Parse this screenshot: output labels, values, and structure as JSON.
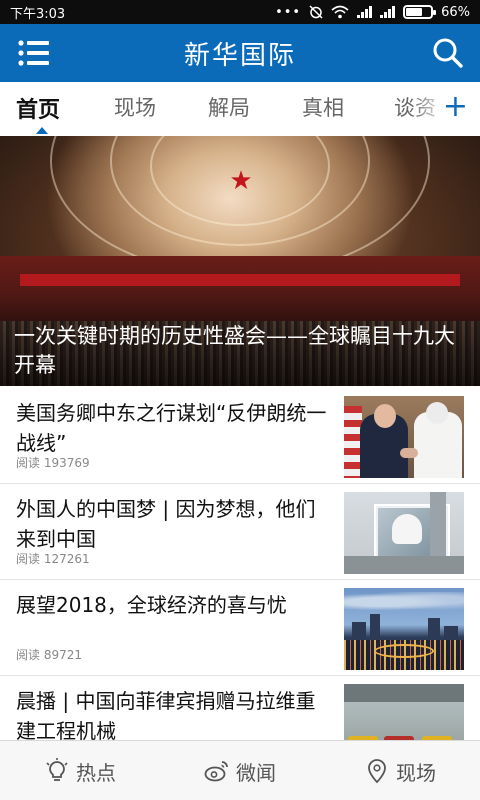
{
  "status_bar": {
    "time": "下午3:03",
    "battery_percent": "66%",
    "battery_level": 0.66
  },
  "header": {
    "title": "新华国际"
  },
  "tabs": [
    {
      "label": "首页",
      "active": true
    },
    {
      "label": "现场",
      "active": false
    },
    {
      "label": "解局",
      "active": false
    },
    {
      "label": "真相",
      "active": false
    },
    {
      "label": "谈资",
      "active": false
    }
  ],
  "tab_add_label": "+",
  "hero": {
    "caption": "一次关键时期的历史性盛会——全球瞩目十九大开幕"
  },
  "news": [
    {
      "title": "美国务卿中东之行谋划“反伊朗统一战线”",
      "reads": "阅读 193769"
    },
    {
      "title": "外国人的中国梦 | 因为梦想，他们来到中国",
      "reads": "阅读 127261"
    },
    {
      "title": "展望2018，全球经济的喜与忧",
      "reads": "阅读 89721"
    },
    {
      "title": "晨播 | 中国向菲律宾捐赠马拉维重建工程机械",
      "reads": ""
    }
  ],
  "bottom_nav": [
    {
      "label": "热点",
      "icon": "lightbulb-icon"
    },
    {
      "label": "微闻",
      "icon": "weibo-icon"
    },
    {
      "label": "现场",
      "icon": "location-pin-icon"
    }
  ],
  "colors": {
    "brand_blue": "#0b6bb9",
    "status_bar": "#0d0d0d"
  }
}
